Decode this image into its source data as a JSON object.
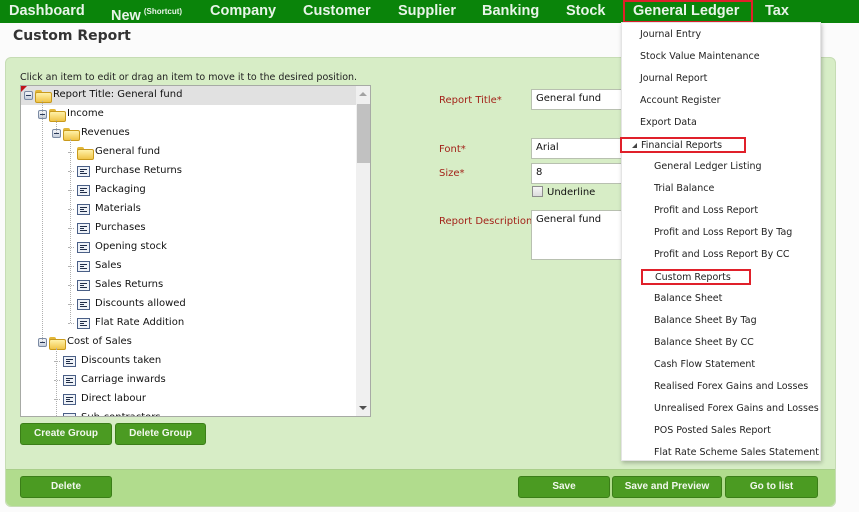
{
  "nav": {
    "items": [
      {
        "label": "Dashboard"
      },
      {
        "label": "New",
        "sup": "(Shortcut)"
      },
      {
        "label": "Company"
      },
      {
        "label": "Customer"
      },
      {
        "label": "Supplier"
      },
      {
        "label": "Banking"
      },
      {
        "label": "Stock"
      },
      {
        "label": "General Ledger",
        "active": true
      },
      {
        "label": "Tax"
      }
    ]
  },
  "page": {
    "title": "Custom Report"
  },
  "tree": {
    "hint": "Click an item to edit or drag an item to move it to the desired position.",
    "nodes": [
      {
        "label": "Report Title: General fund",
        "type": "folder",
        "level": 0,
        "expanded": true,
        "selected": true
      },
      {
        "label": "Income",
        "type": "folder",
        "level": 1,
        "expanded": true
      },
      {
        "label": "Revenues",
        "type": "folder",
        "level": 2,
        "expanded": true
      },
      {
        "label": "General fund",
        "type": "folder",
        "level": 3
      },
      {
        "label": "Purchase Returns",
        "type": "leaf",
        "level": 3
      },
      {
        "label": "Packaging",
        "type": "leaf",
        "level": 3
      },
      {
        "label": "Materials",
        "type": "leaf",
        "level": 3
      },
      {
        "label": "Purchases",
        "type": "leaf",
        "level": 3
      },
      {
        "label": "Opening stock",
        "type": "leaf",
        "level": 3
      },
      {
        "label": "Sales",
        "type": "leaf",
        "level": 3
      },
      {
        "label": "Sales Returns",
        "type": "leaf",
        "level": 3
      },
      {
        "label": "Discounts allowed",
        "type": "leaf",
        "level": 3
      },
      {
        "label": "Flat Rate Addition",
        "type": "leaf",
        "level": 3
      },
      {
        "label": "Cost of Sales",
        "type": "folder",
        "level": 1,
        "expanded": true
      },
      {
        "label": "Discounts taken",
        "type": "leaf",
        "level": 2
      },
      {
        "label": "Carriage inwards",
        "type": "leaf",
        "level": 2
      },
      {
        "label": "Direct labour",
        "type": "leaf",
        "level": 2
      },
      {
        "label": "Sub-contractors",
        "type": "leaf",
        "level": 2
      }
    ],
    "buttons": {
      "create_group": "Create Group",
      "delete_group": "Delete Group"
    }
  },
  "form": {
    "report_title_label": "Report Title*",
    "report_title_value": "General fund",
    "font_label": "Font*",
    "font_value": "Arial",
    "size_label": "Size*",
    "size_value": "8",
    "underline_label": "Underline",
    "underline_checked": false,
    "description_label": "Report Description*",
    "description_value": "General fund"
  },
  "footer": {
    "delete": "Delete",
    "save": "Save",
    "save_preview": "Save and Preview",
    "go_to_list": "Go to list"
  },
  "dropdown": {
    "items": [
      {
        "label": "Journal Entry",
        "indent": 0
      },
      {
        "label": "Stock Value Maintenance",
        "indent": 0
      },
      {
        "label": "Journal Report",
        "indent": 0
      },
      {
        "label": "Account Register",
        "indent": 0
      },
      {
        "label": "Export Data",
        "indent": 0
      },
      {
        "label": "Financial Reports",
        "indent": 0,
        "group": true,
        "highlighted": true
      },
      {
        "label": "General Ledger Listing",
        "indent": 1
      },
      {
        "label": "Trial Balance",
        "indent": 1
      },
      {
        "label": "Profit and Loss Report",
        "indent": 1
      },
      {
        "label": "Profit and Loss Report By Tag",
        "indent": 1
      },
      {
        "label": "Profit and Loss Report By CC",
        "indent": 1
      },
      {
        "label": "Custom Reports",
        "indent": 1,
        "highlighted": true
      },
      {
        "label": "Balance Sheet",
        "indent": 1
      },
      {
        "label": "Balance Sheet By Tag",
        "indent": 1
      },
      {
        "label": "Balance Sheet By CC",
        "indent": 1
      },
      {
        "label": "Cash Flow Statement",
        "indent": 1
      },
      {
        "label": "Realised Forex Gains and Losses",
        "indent": 1
      },
      {
        "label": "Unrealised Forex Gains and Losses",
        "indent": 1
      },
      {
        "label": "POS Posted Sales Report",
        "indent": 1
      },
      {
        "label": "Flat Rate Scheme Sales Statement",
        "indent": 1
      }
    ]
  },
  "colors": {
    "nav_bg": "#0a840a",
    "button_green": "#4b9b22",
    "highlight_red": "#e0202a",
    "panel_bg": "#d7edc6",
    "label_red": "#a3231a"
  }
}
